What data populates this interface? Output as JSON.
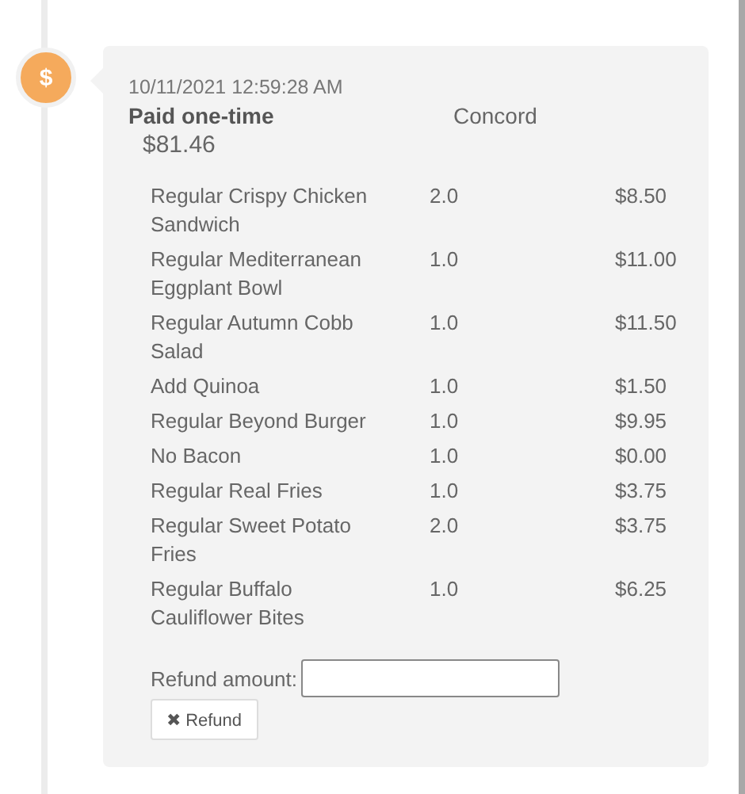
{
  "event": {
    "icon": "$",
    "timestamp": "10/11/2021 12:59:28 AM",
    "title": "Paid one-time",
    "location": "Concord",
    "amount": "$81.46"
  },
  "items": [
    {
      "name": "Regular Crispy Chicken Sandwich",
      "qty": "2.0",
      "price": "$8.50"
    },
    {
      "name": "Regular Mediterranean Eggplant Bowl",
      "qty": "1.0",
      "price": "$11.00"
    },
    {
      "name": "Regular Autumn Cobb Salad",
      "qty": "1.0",
      "price": "$11.50"
    },
    {
      "name": "Add Quinoa",
      "qty": "1.0",
      "price": "$1.50"
    },
    {
      "name": "Regular Beyond Burger",
      "qty": "1.0",
      "price": "$9.95"
    },
    {
      "name": "No Bacon",
      "qty": "1.0",
      "price": "$0.00"
    },
    {
      "name": "Regular Real Fries",
      "qty": "1.0",
      "price": "$3.75"
    },
    {
      "name": "Regular Sweet Potato Fries",
      "qty": "2.0",
      "price": "$3.75"
    },
    {
      "name": "Regular Buffalo Cauliflower Bites",
      "qty": "1.0",
      "price": "$6.25"
    }
  ],
  "refund": {
    "label": "Refund amount:",
    "button_icon": "✖",
    "button": "Refund"
  }
}
